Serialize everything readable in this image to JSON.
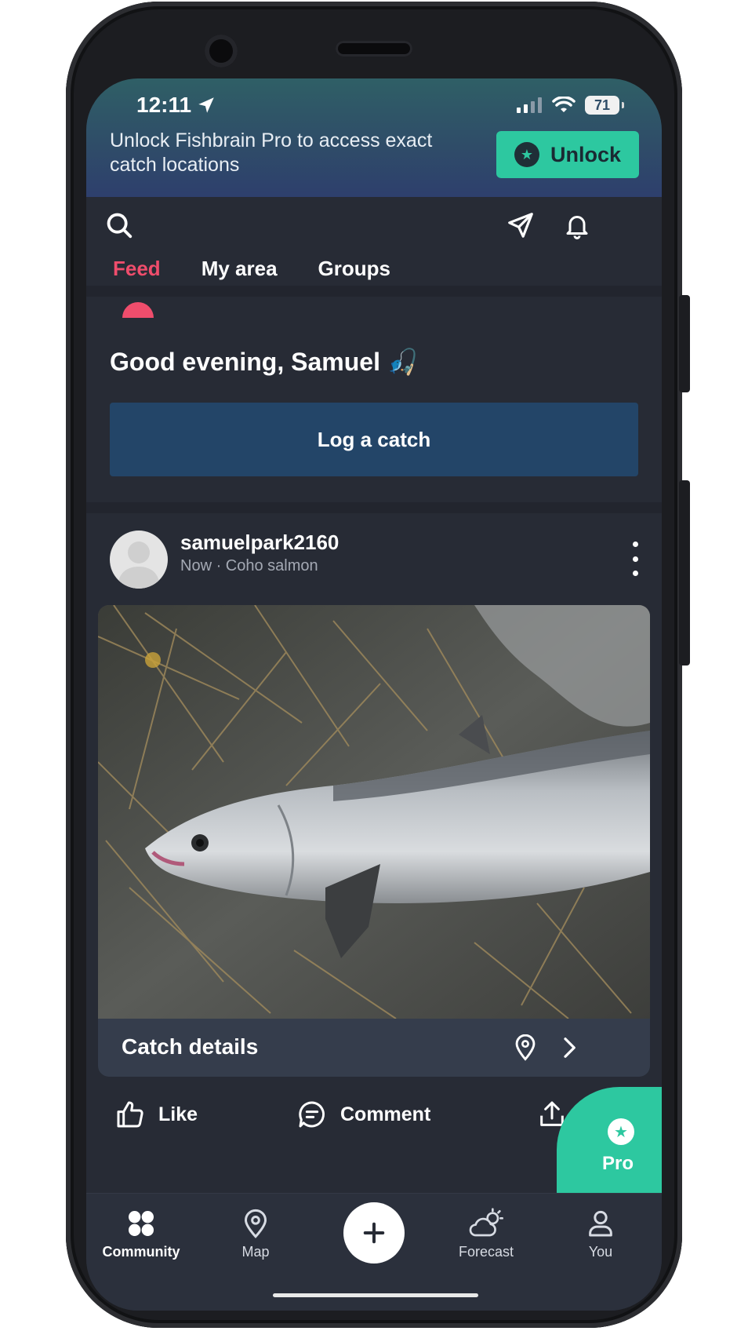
{
  "status_bar": {
    "time": "12:11",
    "battery": "71"
  },
  "promo": {
    "message": "Unlock Fishbrain Pro to access exact catch locations",
    "button_label": "Unlock"
  },
  "tabs": [
    {
      "label": "Feed",
      "active": true
    },
    {
      "label": "My area",
      "active": false
    },
    {
      "label": "Groups",
      "active": false
    }
  ],
  "greeting": "Good evening, Samuel 🎣",
  "log_catch_label": "Log a catch",
  "post": {
    "username": "samuelpark2160",
    "meta": "Now · Coho salmon",
    "details_label": "Catch details",
    "actions": {
      "like": "Like",
      "comment": "Comment",
      "share": "S"
    }
  },
  "pro_fab_label": "Pro",
  "bottom_nav": [
    {
      "label": "Community",
      "icon": "community-icon",
      "active": true
    },
    {
      "label": "Map",
      "icon": "map-pin-icon",
      "active": false
    },
    {
      "label": "Forecast",
      "icon": "weather-icon",
      "active": false
    },
    {
      "label": "You",
      "icon": "person-icon",
      "active": false
    }
  ],
  "colors": {
    "accent_green": "#2dc8a0",
    "active_tab": "#ef4d6c",
    "background": "#272b35",
    "log_button": "#234568"
  }
}
